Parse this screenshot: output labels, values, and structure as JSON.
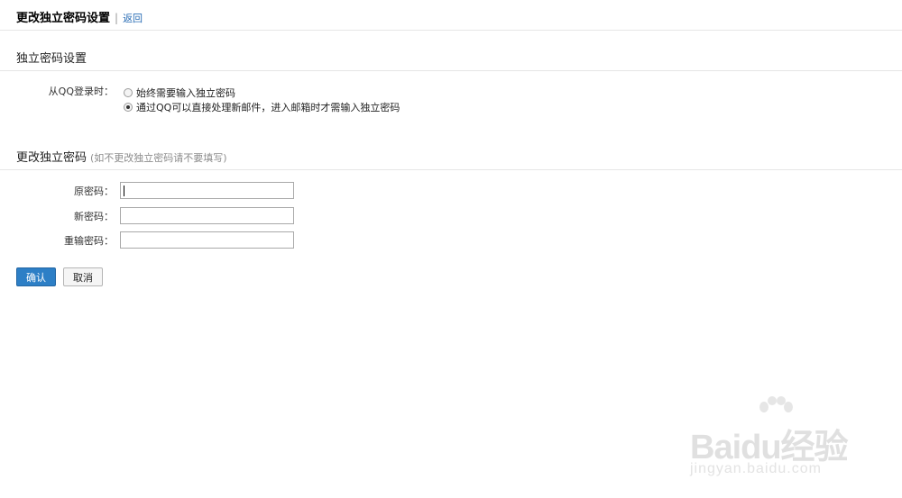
{
  "header": {
    "title": "更改独立密码设置",
    "separator": "|",
    "back_link": "返回"
  },
  "independent_password": {
    "section_title": "独立密码设置",
    "qq_login_label": "从QQ登录时：",
    "options": [
      {
        "label": "始终需要输入独立密码",
        "checked": false
      },
      {
        "label": "通过QQ可以直接处理新邮件，进入邮箱时才需输入独立密码",
        "checked": true
      }
    ]
  },
  "change_password": {
    "section_title": "更改独立密码",
    "section_hint": "(如不更改独立密码请不要填写)",
    "fields": [
      {
        "label": "原密码：",
        "value": ""
      },
      {
        "label": "新密码：",
        "value": ""
      },
      {
        "label": "重输密码：",
        "value": ""
      }
    ]
  },
  "actions": {
    "confirm_label": "确认",
    "cancel_label": "取消"
  },
  "watermark": {
    "brand": "Baidu经验",
    "url": "jingyan.baidu.com"
  },
  "colors": {
    "link": "#2a6db5",
    "primary_button": "#2d7fc6",
    "divider": "#e6e6e6"
  }
}
